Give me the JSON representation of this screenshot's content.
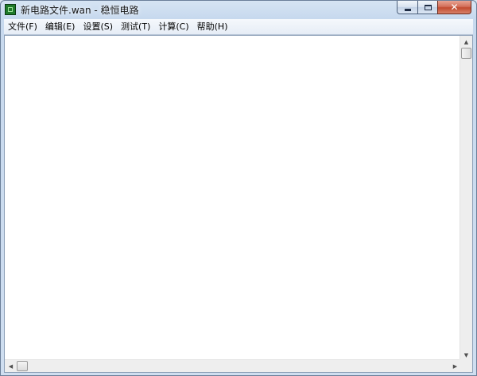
{
  "window": {
    "title": "新电路文件.wan - 稳恒电路",
    "app_icon": "circuit-app-icon",
    "caption_buttons": {
      "minimize": "minimize-icon",
      "maximize": "maximize-icon",
      "close": "close-icon",
      "close_glyph": "✕"
    }
  },
  "menubar": {
    "items": [
      {
        "label": "文件(F)"
      },
      {
        "label": "编辑(E)"
      },
      {
        "label": "设置(S)"
      },
      {
        "label": "测试(T)"
      },
      {
        "label": "计算(C)"
      },
      {
        "label": "帮助(H)"
      }
    ]
  },
  "scrollbars": {
    "up_glyph": "▲",
    "down_glyph": "▼",
    "left_glyph": "◀",
    "right_glyph": "▶"
  },
  "colors": {
    "close_button": "#c24b2f",
    "app_icon": "#1f7a2a",
    "canvas": "#ffffff"
  }
}
